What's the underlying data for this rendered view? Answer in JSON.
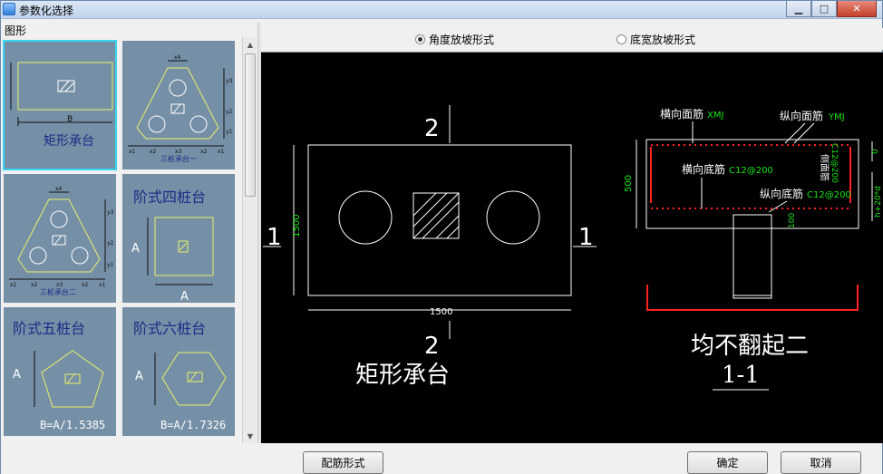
{
  "window": {
    "title": "参数化选择",
    "min_glyph": "▁",
    "max_glyph": "□",
    "close_glyph": "✕"
  },
  "left_panel": {
    "label": "图形",
    "tiles": [
      {
        "title": "矩形承台",
        "dim_label": "B"
      },
      {
        "caption": "三桩承台一",
        "dims": [
          "x4",
          "y3",
          "y2",
          "y1",
          "x1",
          "x2",
          "x3",
          "x2",
          "x1"
        ]
      },
      {
        "caption": "三桩承台二",
        "dims": [
          "x4",
          "y3",
          "y2",
          "y1",
          "x1",
          "x2",
          "x3",
          "x2",
          "x1"
        ]
      },
      {
        "title": "阶式四桩台",
        "dim_a_vertical": "A",
        "dim_a_horizontal": "A"
      },
      {
        "title": "阶式五桩台",
        "dim_a": "A",
        "formula": "B=A/1.5385"
      },
      {
        "title": "阶式六桩台",
        "dim_a": "A",
        "formula": "B=A/1.7326"
      }
    ]
  },
  "options": {
    "radio_angle": "角度放坡形式",
    "radio_width": "底宽放坡形式",
    "selected": "radio_angle"
  },
  "drawing": {
    "plan": {
      "top_mark": "2",
      "bottom_mark": "2",
      "left_mark": "1",
      "right_mark": "1",
      "width_dim": "1500",
      "height_dim": "1500",
      "title": "矩形承台"
    },
    "section": {
      "label_h_top": "横向面筋",
      "code_h_top": "XMJ",
      "label_v_top": "纵向面筋",
      "code_v_top": "YMJ",
      "label_h_bot": "横向底筋",
      "code_h_bot": "C12@200",
      "label_v_bot": "纵向底筋",
      "code_v_bot": "C12@200",
      "label_side": "侧面筋",
      "code_side": "C12@200",
      "height_dim": "500",
      "dim_zero": "0",
      "dim_formula": "h+20*d",
      "dim_100": "100",
      "title": "均不翻起二",
      "section_mark": "1-1"
    }
  },
  "buttons": {
    "rebar_form": "配筋形式",
    "ok": "确定",
    "cancel": "取消"
  },
  "colors": {
    "accent_selected": "#39d4ef",
    "tile_bg": "#758fa6",
    "canvas_bg": "#000000",
    "rebar_red": "#ff2020",
    "dim_green": "#19e619",
    "sketch_yellow": "#e9f06a"
  }
}
